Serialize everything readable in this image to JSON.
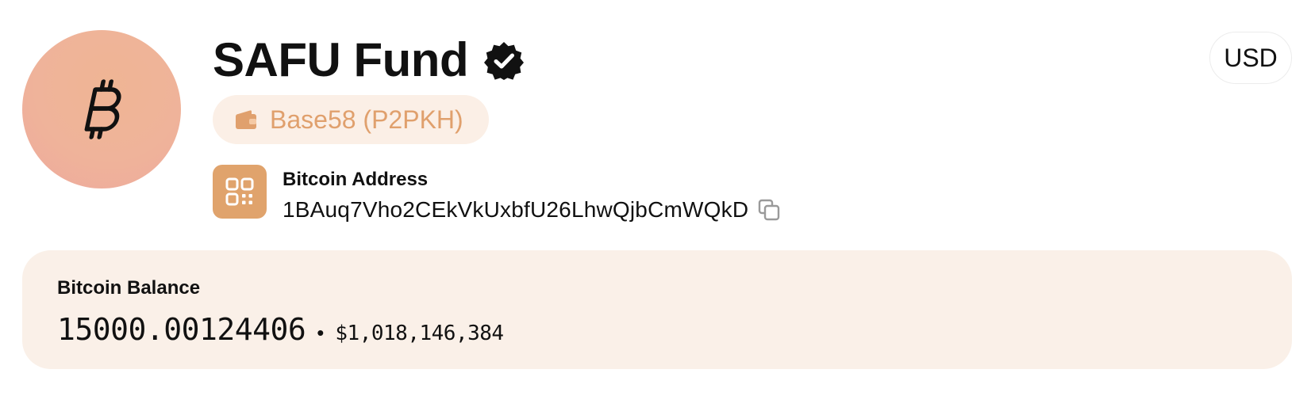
{
  "profile": {
    "name": "SAFU Fund",
    "avatar_icon": "bitcoin-icon",
    "verified_icon": "verified-badge-icon"
  },
  "address_type": {
    "icon": "wallet-icon",
    "label": "Base58 (P2PKH)"
  },
  "address": {
    "qr_icon": "qr-code-icon",
    "label": "Bitcoin Address",
    "value": "1BAuq7Vho2CEkVkUxbfU26LhwQjbCmWQkD",
    "copy_icon": "copy-icon"
  },
  "currency": {
    "label": "USD"
  },
  "balance": {
    "label": "Bitcoin Balance",
    "btc": "15000.00124406",
    "separator": "•",
    "fiat": "$1,018,146,384"
  },
  "colors": {
    "accent": "#e0a36c",
    "pill_bg": "#fbefe6",
    "card_bg": "#faf0e8",
    "avatar_bg": "#efb39a"
  }
}
